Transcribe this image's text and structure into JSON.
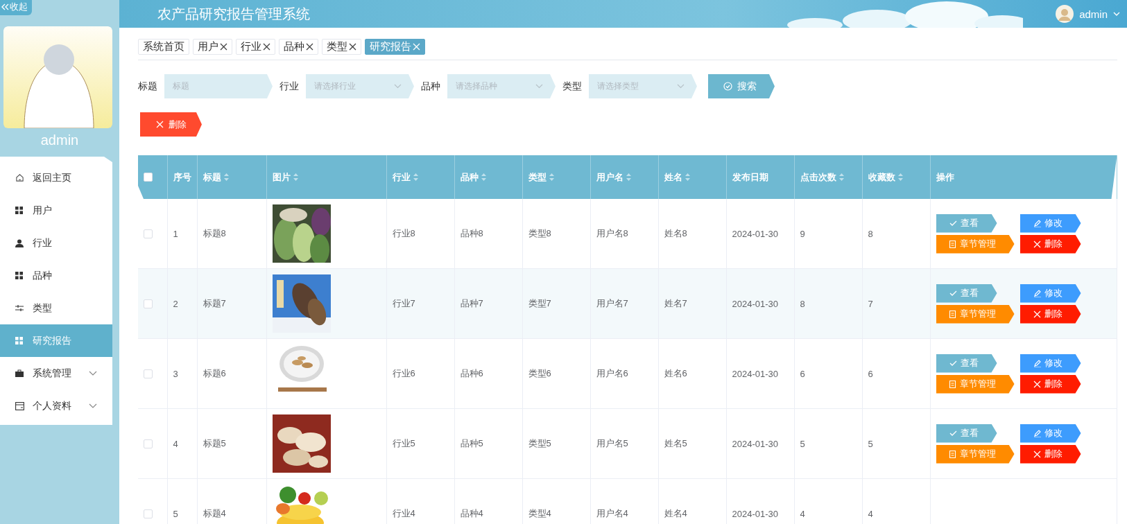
{
  "sidebar": {
    "collapse_label": "收起",
    "username": "admin",
    "items": [
      {
        "label": "返回主页",
        "selected": false
      },
      {
        "label": "用户",
        "selected": false
      },
      {
        "label": "行业",
        "selected": false
      },
      {
        "label": "品种",
        "selected": false
      },
      {
        "label": "类型",
        "selected": false
      },
      {
        "label": "研究报告",
        "selected": true
      },
      {
        "label": "系统管理",
        "selected": false,
        "expanded": false
      },
      {
        "label": "个人资料",
        "selected": false,
        "expanded": false
      }
    ]
  },
  "header": {
    "title": "农产品研究报告管理系统",
    "user": "admin"
  },
  "tabs": [
    {
      "label": "系统首页",
      "selected": false,
      "closable": false
    },
    {
      "label": "用户",
      "selected": false,
      "closable": true
    },
    {
      "label": "行业",
      "selected": false,
      "closable": true
    },
    {
      "label": "品种",
      "selected": false,
      "closable": true
    },
    {
      "label": "类型",
      "selected": false,
      "closable": true
    },
    {
      "label": "研究报告",
      "selected": true,
      "closable": true
    }
  ],
  "search": {
    "fields": [
      {
        "label": "标题",
        "kind": "text",
        "placeholder": "标题"
      },
      {
        "label": "行业",
        "kind": "select",
        "placeholder": "请选择行业"
      },
      {
        "label": "品种",
        "kind": "select",
        "placeholder": "请选择品种"
      },
      {
        "label": "类型",
        "kind": "select",
        "placeholder": "请选择类型"
      }
    ],
    "button": "搜索"
  },
  "toolbar": {
    "delete_button": "删除"
  },
  "table": {
    "all_checked": false,
    "columns": [
      {
        "label": "序号",
        "kind": "text",
        "sortable": false
      },
      {
        "label": "标题",
        "kind": "text",
        "sortable": true
      },
      {
        "label": "图片",
        "sortable": true
      },
      {
        "label": "行业",
        "kind": "text",
        "sortable": true
      },
      {
        "label": "品种",
        "kind": "text",
        "sortable": true
      },
      {
        "label": "类型",
        "kind": "text",
        "sortable": true
      },
      {
        "label": "用户名",
        "kind": "text",
        "sortable": true
      },
      {
        "label": "姓名",
        "kind": "text",
        "sortable": true
      },
      {
        "label": "发布日期",
        "kind": "text",
        "sortable": false
      },
      {
        "label": "点击次数",
        "kind": "text",
        "sortable": true
      },
      {
        "label": "收藏数",
        "kind": "text",
        "sortable": true
      },
      {
        "label": "操作",
        "kind": "actions",
        "sortable": false
      }
    ],
    "rows": [
      {
        "checked": false,
        "hovered": false,
        "cells": [
          "1",
          "标题8",
          null,
          "行业8",
          "品种8",
          "类型8",
          "用户名8",
          "姓名8",
          "2024-01-30",
          "9",
          "8"
        ],
        "actions": [
          {
            "kind": "view",
            "label": "查看"
          },
          {
            "kind": "edit",
            "label": "修改"
          },
          {
            "kind": "chapters",
            "label": "章节管理"
          },
          {
            "kind": "delete",
            "label": "删除"
          }
        ]
      },
      {
        "checked": false,
        "hovered": true,
        "cells": [
          "2",
          "标题7",
          null,
          "行业7",
          "品种7",
          "类型7",
          "用户名7",
          "姓名7",
          "2024-01-30",
          "8",
          "7"
        ],
        "actions": [
          {
            "kind": "view",
            "label": "查看"
          },
          {
            "kind": "edit",
            "label": "修改"
          },
          {
            "kind": "chapters",
            "label": "章节管理"
          },
          {
            "kind": "delete",
            "label": "删除"
          }
        ]
      },
      {
        "checked": false,
        "hovered": false,
        "cells": [
          "3",
          "标题6",
          null,
          "行业6",
          "品种6",
          "类型6",
          "用户名6",
          "姓名6",
          "2024-01-30",
          "6",
          "6"
        ],
        "actions": [
          {
            "kind": "view",
            "label": "查看"
          },
          {
            "kind": "edit",
            "label": "修改"
          },
          {
            "kind": "chapters",
            "label": "章节管理"
          },
          {
            "kind": "delete",
            "label": "删除"
          }
        ]
      },
      {
        "checked": false,
        "hovered": false,
        "cells": [
          "4",
          "标题5",
          null,
          "行业5",
          "品种5",
          "类型5",
          "用户名5",
          "姓名5",
          "2024-01-30",
          "5",
          "5"
        ],
        "actions": [
          {
            "kind": "view",
            "label": "查看"
          },
          {
            "kind": "edit",
            "label": "修改"
          },
          {
            "kind": "chapters",
            "label": "章节管理"
          },
          {
            "kind": "delete",
            "label": "删除"
          }
        ]
      },
      {
        "checked": false,
        "hovered": false,
        "cells": [
          "5",
          "标题4",
          null,
          "行业4",
          "品种4",
          "类型4",
          "用户名4",
          "姓名4",
          "2024-01-30",
          "4",
          "4"
        ]
      }
    ]
  }
}
